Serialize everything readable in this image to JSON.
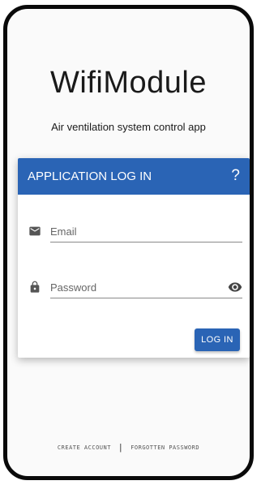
{
  "app": {
    "title": "WifiModule",
    "subtitle": "Air ventilation system control app"
  },
  "login_card": {
    "title": "APPLICATION LOG IN",
    "help_icon": "question-mark-icon",
    "help_symbol": "?",
    "email": {
      "icon": "envelope-icon",
      "placeholder": "Email",
      "value": ""
    },
    "password": {
      "icon": "lock-icon",
      "placeholder": "Password",
      "value": "",
      "toggle_icon": "eye-icon"
    },
    "login_label": "LOG IN"
  },
  "footer": {
    "create_account": "CREATE ACCOUNT",
    "separator": "|",
    "forgotten_password": "FORGOTTEN PASSWORD"
  },
  "colors": {
    "accent": "#2a64b5",
    "frame": "#0a0a0a",
    "background": "#fafafa"
  }
}
